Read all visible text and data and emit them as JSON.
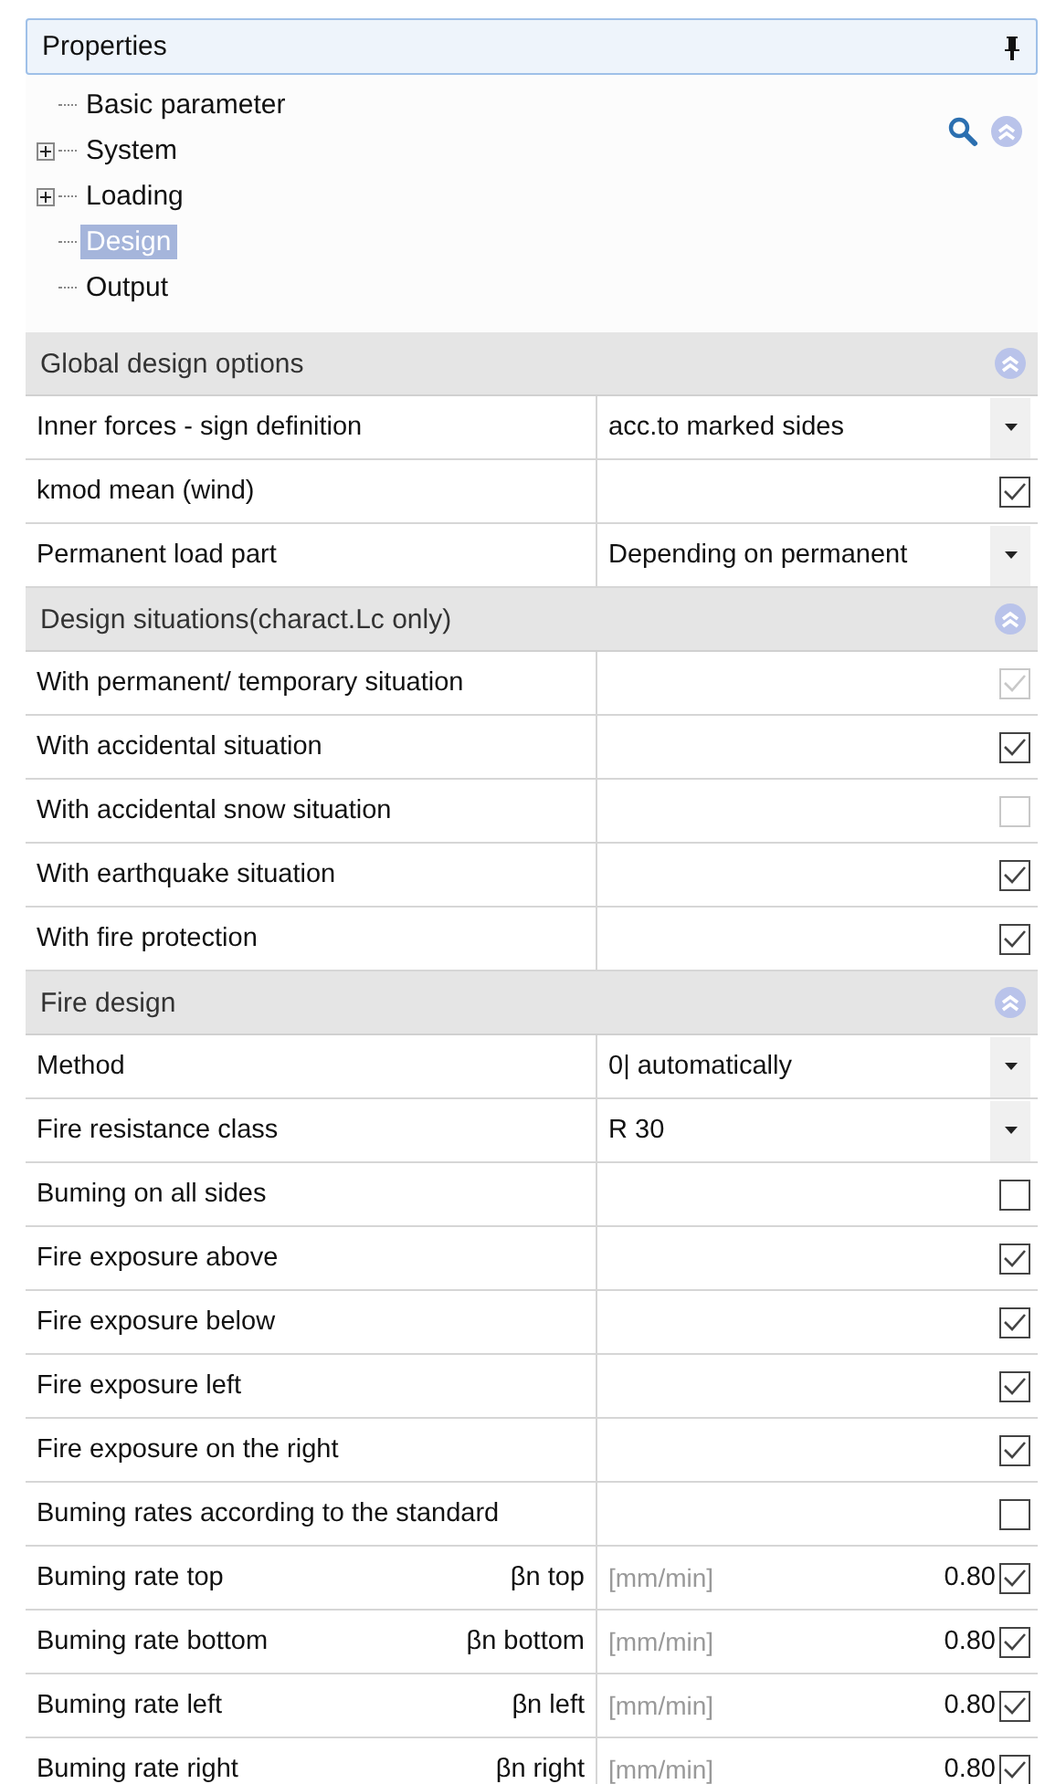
{
  "panel": {
    "title": "Properties"
  },
  "tree": [
    {
      "label": "Basic parameter",
      "selected": false
    },
    {
      "label": "System",
      "selected": false,
      "expanded": false
    },
    {
      "label": "Loading",
      "selected": false,
      "expanded": false
    },
    {
      "label": "Design",
      "selected": true
    },
    {
      "label": "Output",
      "selected": false
    }
  ],
  "sections": [
    {
      "title": "Global design options",
      "expanded": true,
      "rows": [
        {
          "kind": "dropdown",
          "label": "Inner forces - sign definition",
          "value": "acc.to marked sides"
        },
        {
          "kind": "checkbox",
          "label": "kmod mean (wind)",
          "checked": true,
          "disabled": false
        },
        {
          "kind": "dropdown",
          "label": "Permanent load part",
          "value": "Depending on permanent"
        }
      ]
    },
    {
      "title": "Design situations(charact.Lc only)",
      "expanded": true,
      "rows": [
        {
          "kind": "checkbox",
          "label": "With permanent/ temporary situation",
          "checked": true,
          "disabled": true
        },
        {
          "kind": "checkbox",
          "label": "With accidental situation",
          "checked": true,
          "disabled": false
        },
        {
          "kind": "checkbox",
          "label": "With accidental snow situation",
          "checked": false,
          "disabled": true
        },
        {
          "kind": "checkbox",
          "label": "With earthquake situation",
          "checked": true,
          "disabled": false
        },
        {
          "kind": "checkbox",
          "label": "With fire protection",
          "checked": true,
          "disabled": false
        }
      ]
    },
    {
      "title": "Fire design",
      "expanded": true,
      "rows": [
        {
          "kind": "dropdown",
          "label": "Method",
          "value": "0| automatically"
        },
        {
          "kind": "dropdown",
          "label": "Fire resistance class",
          "value": "R 30"
        },
        {
          "kind": "checkbox",
          "label": "Buming on all sides",
          "checked": false,
          "disabled": false
        },
        {
          "kind": "checkbox",
          "label": "Fire exposure above",
          "checked": true,
          "disabled": false
        },
        {
          "kind": "checkbox",
          "label": "Fire exposure below",
          "checked": true,
          "disabled": false
        },
        {
          "kind": "checkbox",
          "label": "Fire exposure left",
          "checked": true,
          "disabled": false
        },
        {
          "kind": "checkbox",
          "label": "Fire exposure on the right",
          "checked": true,
          "disabled": false
        },
        {
          "kind": "checkbox",
          "label": "Buming rates according to the standard",
          "checked": false,
          "disabled": false
        },
        {
          "kind": "rate",
          "label": "Buming rate top",
          "symbol": "βn top",
          "unit": "[mm/min]",
          "value": "0.80",
          "checked": true
        },
        {
          "kind": "rate",
          "label": "Buming rate bottom",
          "symbol": "βn bottom",
          "unit": "[mm/min]",
          "value": "0.80",
          "checked": true
        },
        {
          "kind": "rate",
          "label": "Buming rate left",
          "symbol": "βn left",
          "unit": "[mm/min]",
          "value": "0.80",
          "checked": true
        },
        {
          "kind": "rate",
          "label": "Buming rate right",
          "symbol": "βn right",
          "unit": "[mm/min]",
          "value": "0.80",
          "checked": true
        }
      ]
    }
  ]
}
